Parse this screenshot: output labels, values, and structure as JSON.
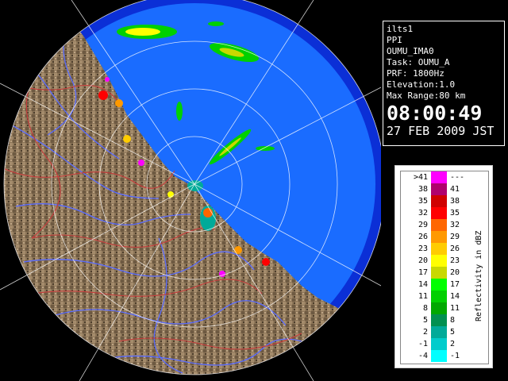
{
  "info": {
    "radar_id": "ilts1",
    "scan_type": "PPI",
    "site": "OUMU_IMA0",
    "task": "Task: OUMU_A",
    "prf": "PRF: 1800Hz",
    "elevation": "Elevation:1.0",
    "max_range": "Max Range:80 km",
    "time": "08:00:49",
    "date": "27 FEB 2009 JST"
  },
  "legend": {
    "unit_label": "Reflectivity in dBZ",
    "rows": [
      {
        "lo": ">41",
        "hi": "---",
        "color": "#ff00ff"
      },
      {
        "lo": "38",
        "hi": "41",
        "color": "#b0006e"
      },
      {
        "lo": "35",
        "hi": "38",
        "color": "#d00000"
      },
      {
        "lo": "32",
        "hi": "35",
        "color": "#ff0000"
      },
      {
        "lo": "29",
        "hi": "32",
        "color": "#ff6600"
      },
      {
        "lo": "26",
        "hi": "29",
        "color": "#ff9900"
      },
      {
        "lo": "23",
        "hi": "26",
        "color": "#ffcc00"
      },
      {
        "lo": "20",
        "hi": "23",
        "color": "#ffff00"
      },
      {
        "lo": "17",
        "hi": "20",
        "color": "#c8d800"
      },
      {
        "lo": "14",
        "hi": "17",
        "color": "#00ff00"
      },
      {
        "lo": "11",
        "hi": "14",
        "color": "#00d000"
      },
      {
        "lo": "8",
        "hi": "11",
        "color": "#00a800"
      },
      {
        "lo": "5",
        "hi": "8",
        "color": "#009050"
      },
      {
        "lo": "2",
        "hi": "5",
        "color": "#00aa99"
      },
      {
        "lo": "-1",
        "hi": "2",
        "color": "#00cccc"
      },
      {
        "lo": "-4",
        "hi": "-1",
        "color": "#00ffff"
      }
    ]
  },
  "colors": {
    "sea": "#1a6cff",
    "outer_sea": "#0b2fd6",
    "land": "#8b7355",
    "rivers": "#5a6cff",
    "boundaries": "#c83c3c",
    "range_rings": "#ffffff"
  }
}
